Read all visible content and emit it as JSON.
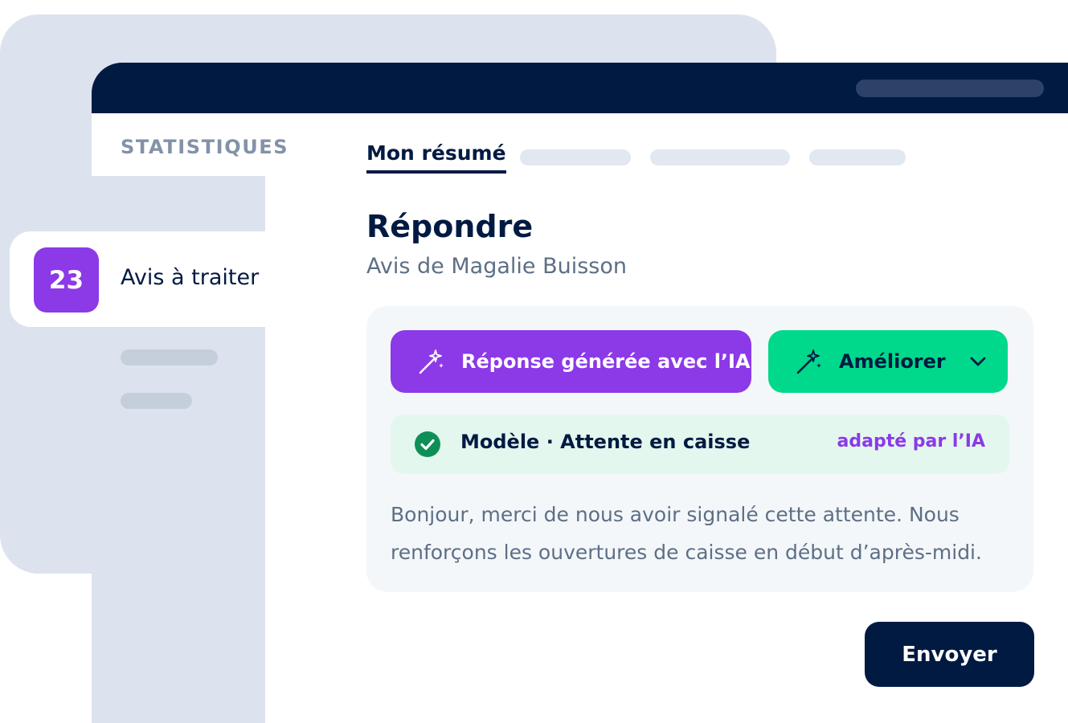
{
  "sidebar": {
    "section_title": "STATISTIQUES",
    "reviews_item": {
      "count": "23",
      "label": "Avis à traiter"
    }
  },
  "tabs": {
    "active": "Mon résumé"
  },
  "main": {
    "title": "Répondre",
    "subtitle": "Avis de Magalie Buisson"
  },
  "reply_card": {
    "ai_button_label": "Réponse générée avec l’IA",
    "improve_button_label": "Améliorer",
    "template": {
      "label": "Modèle · Attente en caisse",
      "tag": "adapté par l’IA"
    },
    "reply_text": "Bonjour, merci de nous avoir signalé cette attente. Nous renforçons les ouvertures de caisse en début d’après-midi."
  },
  "send_button_label": "Envoyer",
  "icons": {
    "ai": "magic-wand-icon",
    "improve": "magic-wand-icon",
    "dropdown": "chevron-down-icon",
    "template_status": "check-circle-icon"
  },
  "colors": {
    "navy": "#001a42",
    "purple": "#8c39e8",
    "green": "#00d98b",
    "success": "#0f8f57",
    "panel": "#dce3ef"
  }
}
